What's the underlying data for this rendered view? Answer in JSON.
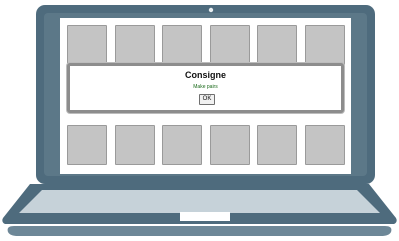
{
  "colors": {
    "laptop_frame": "#4e6b7d",
    "laptop_frame_light": "#6d8797",
    "laptop_base": "#4e6b7d",
    "laptop_base_top": "#c6d2d9",
    "screen": "#ffffff",
    "card": "#c4c4c4",
    "card_border": "#9a9a9a",
    "modal_border": "#8d8d8d",
    "instruction_text": "#1a6a1a"
  },
  "board": {
    "top_row_cards": 6,
    "bottom_row_cards": 6
  },
  "dialog": {
    "title": "Consigne",
    "message": "Make pairs",
    "ok_label": "OK"
  }
}
